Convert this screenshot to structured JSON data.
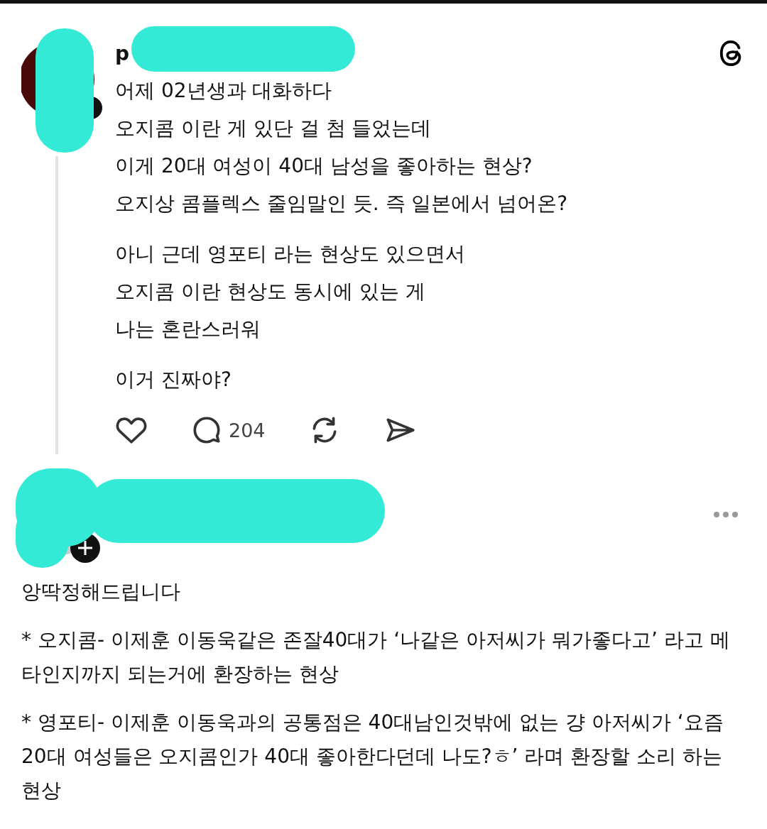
{
  "post": {
    "username": "p",
    "paragraphs": [
      "어제 02년생과 대화하다\n오지콤 이란 게 있단 걸 첨 들었는데\n이게 20대 여성이 40대 남성을 좋아하는 현상?\n오지상 콤플렉스 줄임말인 듯. 즉 일본에서 넘어온?",
      "아니 근데 영포티 라는 현상도 있으면서\n오지콤 이란 현상도 동시에 있는 게\n나는 혼란스러워",
      "이거 진짜야?"
    ],
    "reply_count": "204"
  },
  "reply": {
    "paragraphs": [
      "앙딱정해드립니다",
      "* 오지콤- 이제훈 이동욱같은 존잘40대가 ‘나같은 아저씨가 뭐가좋다고’ 라고 메타인지까지 되는거에 환장하는 현상",
      "* 영포티- 이제훈 이동욱과의 공통점은 40대남인것밖에 없는 걍 아저씨가 ‘요즘 20대 여성들은 오지콤인가 40대 좋아한다던데 나도?ㅎ’ 라며 환장할 소리 하는 현상"
    ]
  }
}
